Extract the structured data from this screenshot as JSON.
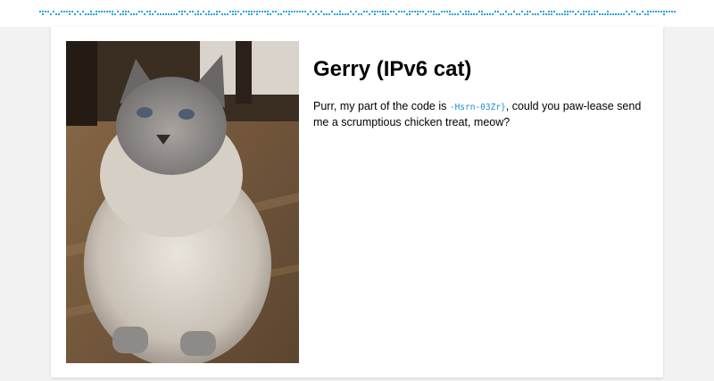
{
  "banner": {
    "colors": {
      "accent": "#29a3e0"
    }
  },
  "cat": {
    "name": "Gerry (IPv6 cat)",
    "message": {
      "before": "Purr, my part of the code is ",
      "code": "-Hsrn-03Zr}",
      "after": ", could you paw-lease send me a scrumptious chicken treat, meow?"
    }
  },
  "colors": {
    "page_background": "#f2f2f2",
    "card_background": "#ffffff",
    "code_text": "#1a8fd6"
  }
}
